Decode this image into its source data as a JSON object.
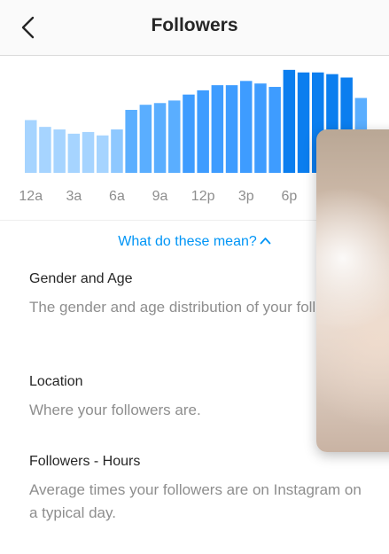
{
  "header": {
    "title": "Followers",
    "back_icon": "chevron-left-icon"
  },
  "chart_data": {
    "type": "bar",
    "tick_labels": [
      "12a",
      "3a",
      "6a",
      "9a",
      "12p",
      "3p",
      "6p"
    ],
    "values": [
      62,
      54,
      51,
      46,
      48,
      44,
      51,
      74,
      80,
      82,
      85,
      92,
      97,
      103,
      103,
      108,
      105,
      101,
      121,
      118,
      118,
      116,
      112,
      88
    ],
    "ylim": [
      0,
      125
    ],
    "colors": [
      "#a6d4ff",
      "#a6d4ff",
      "#a6d4ff",
      "#a6d4ff",
      "#a6d4ff",
      "#a6d4ff",
      "#8ec8ff",
      "#5aaeff",
      "#5aaeff",
      "#5aaeff",
      "#5aaeff",
      "#3e9cff",
      "#3e9cff",
      "#3e9cff",
      "#3e9cff",
      "#3e9cff",
      "#3e9cff",
      "#3e9cff",
      "#0b7eef",
      "#0b7eef",
      "#0b7eef",
      "#0b7eef",
      "#0b7eef",
      "#5aaeff"
    ]
  },
  "help_link": {
    "label": "What do these mean?",
    "icon": "chevron-up-icon"
  },
  "sections": [
    {
      "heading": "Gender and Age",
      "description": "The gender and age distribution of your followers."
    },
    {
      "heading": "Location",
      "description": "Where your followers are."
    },
    {
      "heading": "Followers - Hours",
      "description": "Average times your followers are on Instagram on a typical day."
    }
  ],
  "colors": {
    "accent": "#0095f6",
    "muted_text": "#8e8e8e"
  }
}
